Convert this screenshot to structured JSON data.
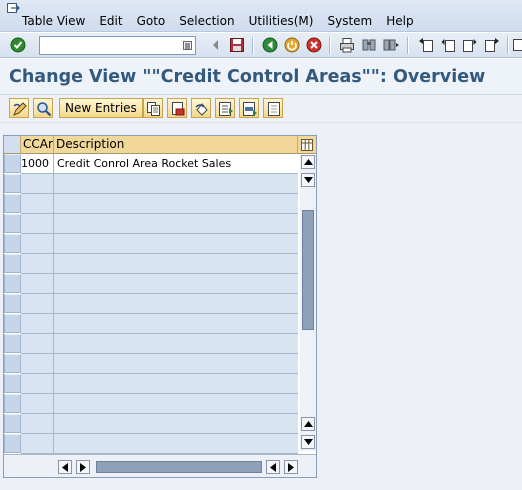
{
  "menu": {
    "items": [
      "Table View",
      "Edit",
      "Goto",
      "Selection",
      "Utilities(M)",
      "System",
      "Help"
    ]
  },
  "toolbar": {
    "command_value": "",
    "icons": [
      "enter-icon",
      "dropdown-icon",
      "back-arrow-icon",
      "save-icon",
      "back-icon",
      "exit-icon",
      "cancel-icon",
      "print-icon",
      "find-icon",
      "find-next-icon",
      "first-page-icon",
      "prev-page-icon",
      "next-page-icon",
      "last-page-icon"
    ]
  },
  "title": "Change View \"\"Credit Control Areas\"\": Overview",
  "app_toolbar": {
    "new_entries_label": "New Entries",
    "icons": [
      "display-change-icon",
      "where-used-icon",
      "copy-icon",
      "delete-icon",
      "undo-icon",
      "select-all-icon",
      "select-block-icon",
      "deselect-all-icon"
    ]
  },
  "table": {
    "columns": [
      "CCAr",
      "Description"
    ],
    "rows": [
      {
        "code": "1000",
        "description": "Credit Conrol Area Rocket Sales"
      }
    ],
    "empty_rows": 14
  },
  "colors": {
    "title": "#33597f",
    "header": "#f1d89a",
    "empty_cell": "#d9e4f2"
  }
}
